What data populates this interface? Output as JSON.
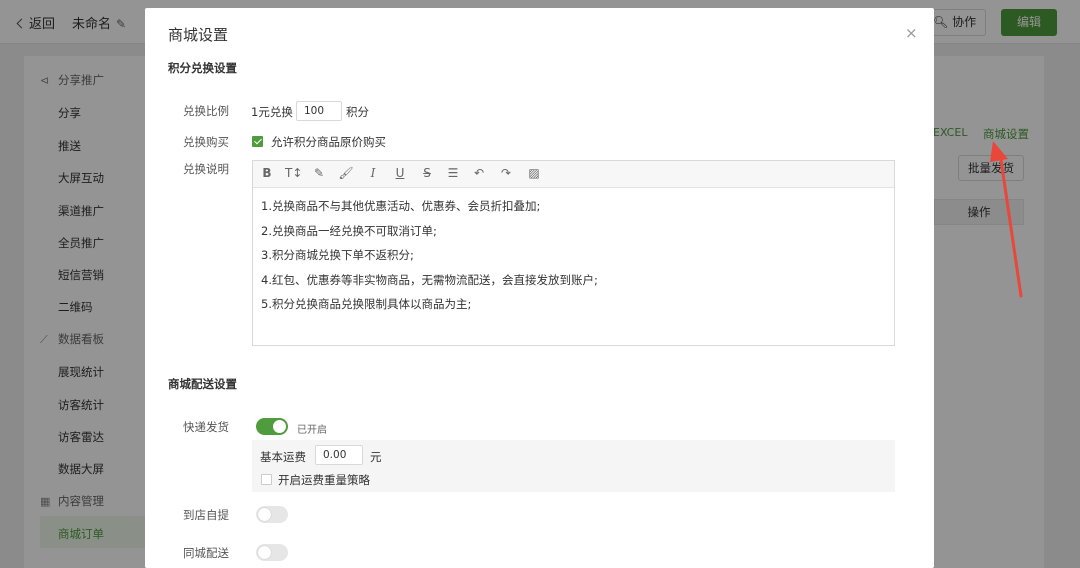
{
  "header": {
    "back_label": "返回",
    "doc_title": "未命名",
    "collab_label": "协作",
    "edit_label": "编辑"
  },
  "sidebar": {
    "groups": [
      {
        "label": "分享推广",
        "icon": "share-icon",
        "items": [
          "分享",
          "推送",
          "大屏互动",
          "渠道推广",
          "全员推广",
          "短信营销",
          "二维码"
        ]
      },
      {
        "label": "数据看板",
        "icon": "chart-icon",
        "items": [
          "展现统计",
          "访客统计",
          "访客雷达",
          "数据大屏"
        ]
      },
      {
        "label": "内容管理",
        "icon": "grid-icon",
        "items": [
          "商城订单"
        ]
      }
    ],
    "active_item": "商城订单"
  },
  "background": {
    "excel_label": "EXCEL",
    "shop_settings_link": "商城设置",
    "batch_button": "批量发货",
    "op_header": "操作"
  },
  "modal": {
    "title": "商城设置",
    "close": "×",
    "exchange_section": "积分兑换设置",
    "ratio_label": "兑换比例",
    "ratio_prefix": "1元兑换",
    "ratio_value": "100",
    "ratio_suffix": "积分",
    "purchase_label": "兑换购买",
    "purchase_checkbox_label": "允许积分商品原价购买",
    "purchase_checked": true,
    "desc_label": "兑换说明",
    "toolbar_icons": [
      "bold-icon",
      "text-size-icon",
      "pen-icon",
      "brush-icon",
      "italic-icon",
      "underline-icon",
      "strikethrough-icon",
      "align-icon",
      "undo-icon",
      "redo-icon",
      "image-icon"
    ],
    "desc_lines": [
      "1.兑换商品不与其他优惠活动、优惠券、会员折扣叠加;",
      "2.兑换商品一经兑换不可取消订单;",
      "3.积分商城兑换下单不返积分;",
      "4.红包、优惠券等非实物商品，无需物流配送，会直接发放到账户;",
      "5.积分兑换商品兑换限制具体以商品为主;"
    ],
    "delivery_section": "商城配送设置",
    "express_label": "快递发货",
    "express_on": true,
    "express_status": "已开启",
    "base_fee_label": "基本运费",
    "base_fee_value": "0.00",
    "base_fee_unit": "元",
    "weight_policy_label": "开启运费重量策略",
    "weight_policy_checked": false,
    "pickup_label": "到店自提",
    "pickup_on": false,
    "city_label": "同城配送",
    "city_on": false
  },
  "colors": {
    "accent": "#4f9b3d",
    "annotation_arrow": "#e8473a"
  }
}
